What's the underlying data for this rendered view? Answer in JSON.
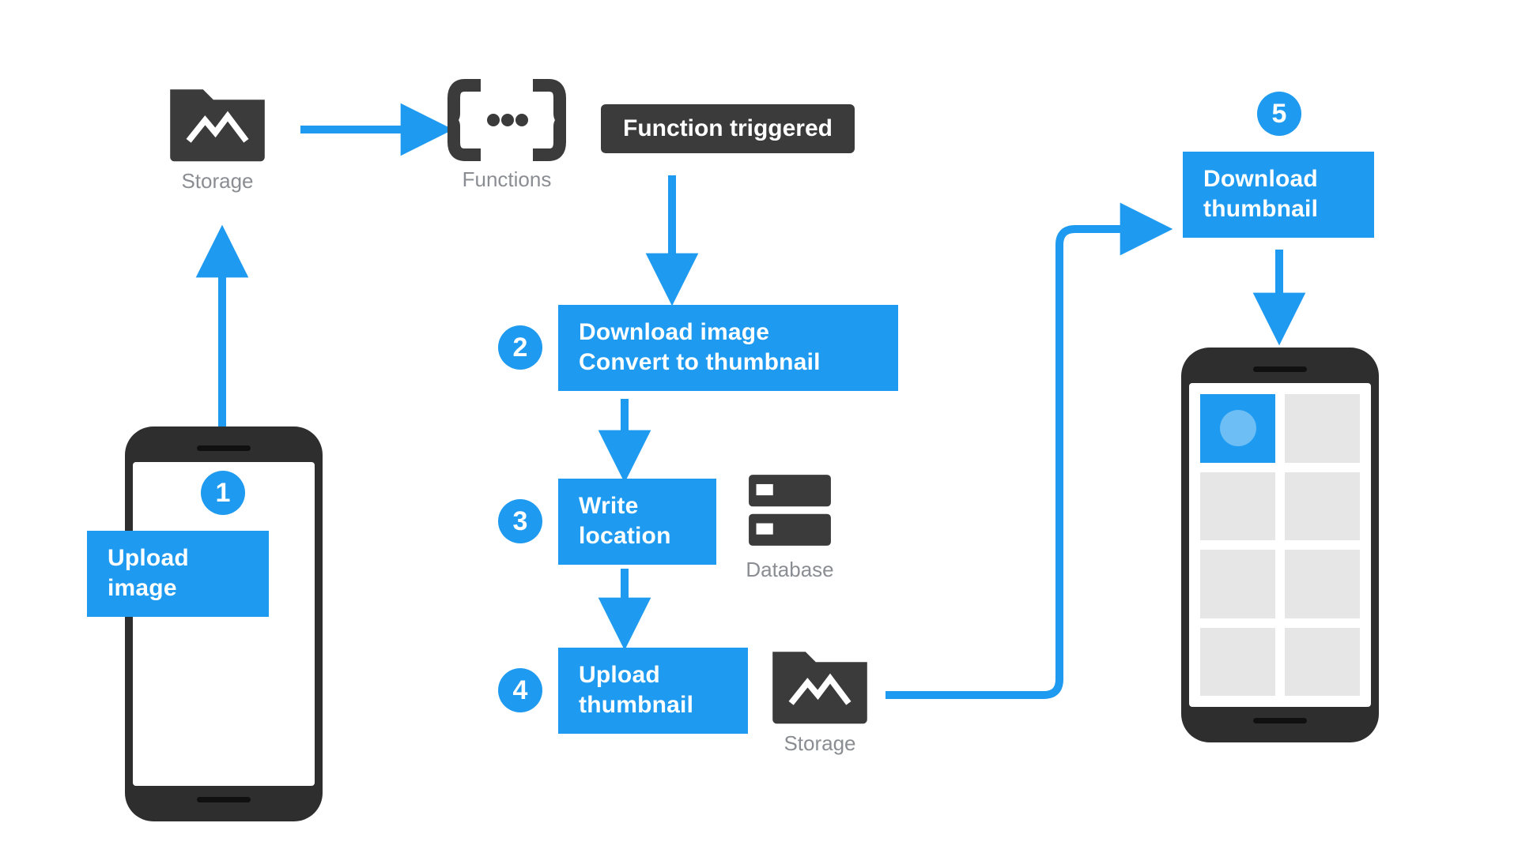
{
  "colors": {
    "accent": "#1e9bf0",
    "dark": "#3b3b3b",
    "muted": "#8a8d92"
  },
  "icons": {
    "storage_top": {
      "name": "storage-folder-icon",
      "caption": "Storage"
    },
    "functions": {
      "name": "functions-icon",
      "caption": "Functions"
    },
    "database": {
      "name": "database-icon",
      "caption": "Database"
    },
    "storage_mid": {
      "name": "storage-folder-icon",
      "caption": "Storage"
    }
  },
  "labels": {
    "trigger": "Function triggered"
  },
  "steps": {
    "1": {
      "num": "1",
      "text": "Upload image"
    },
    "2": {
      "num": "2",
      "text_l1": "Download image",
      "text_l2": "Convert to thumbnail"
    },
    "3": {
      "num": "3",
      "text_l1": "Write",
      "text_l2": "location"
    },
    "4": {
      "num": "4",
      "text_l1": "Upload",
      "text_l2": "thumbnail"
    },
    "5": {
      "num": "5",
      "text_l1": "Download",
      "text_l2": "thumbnail"
    }
  }
}
